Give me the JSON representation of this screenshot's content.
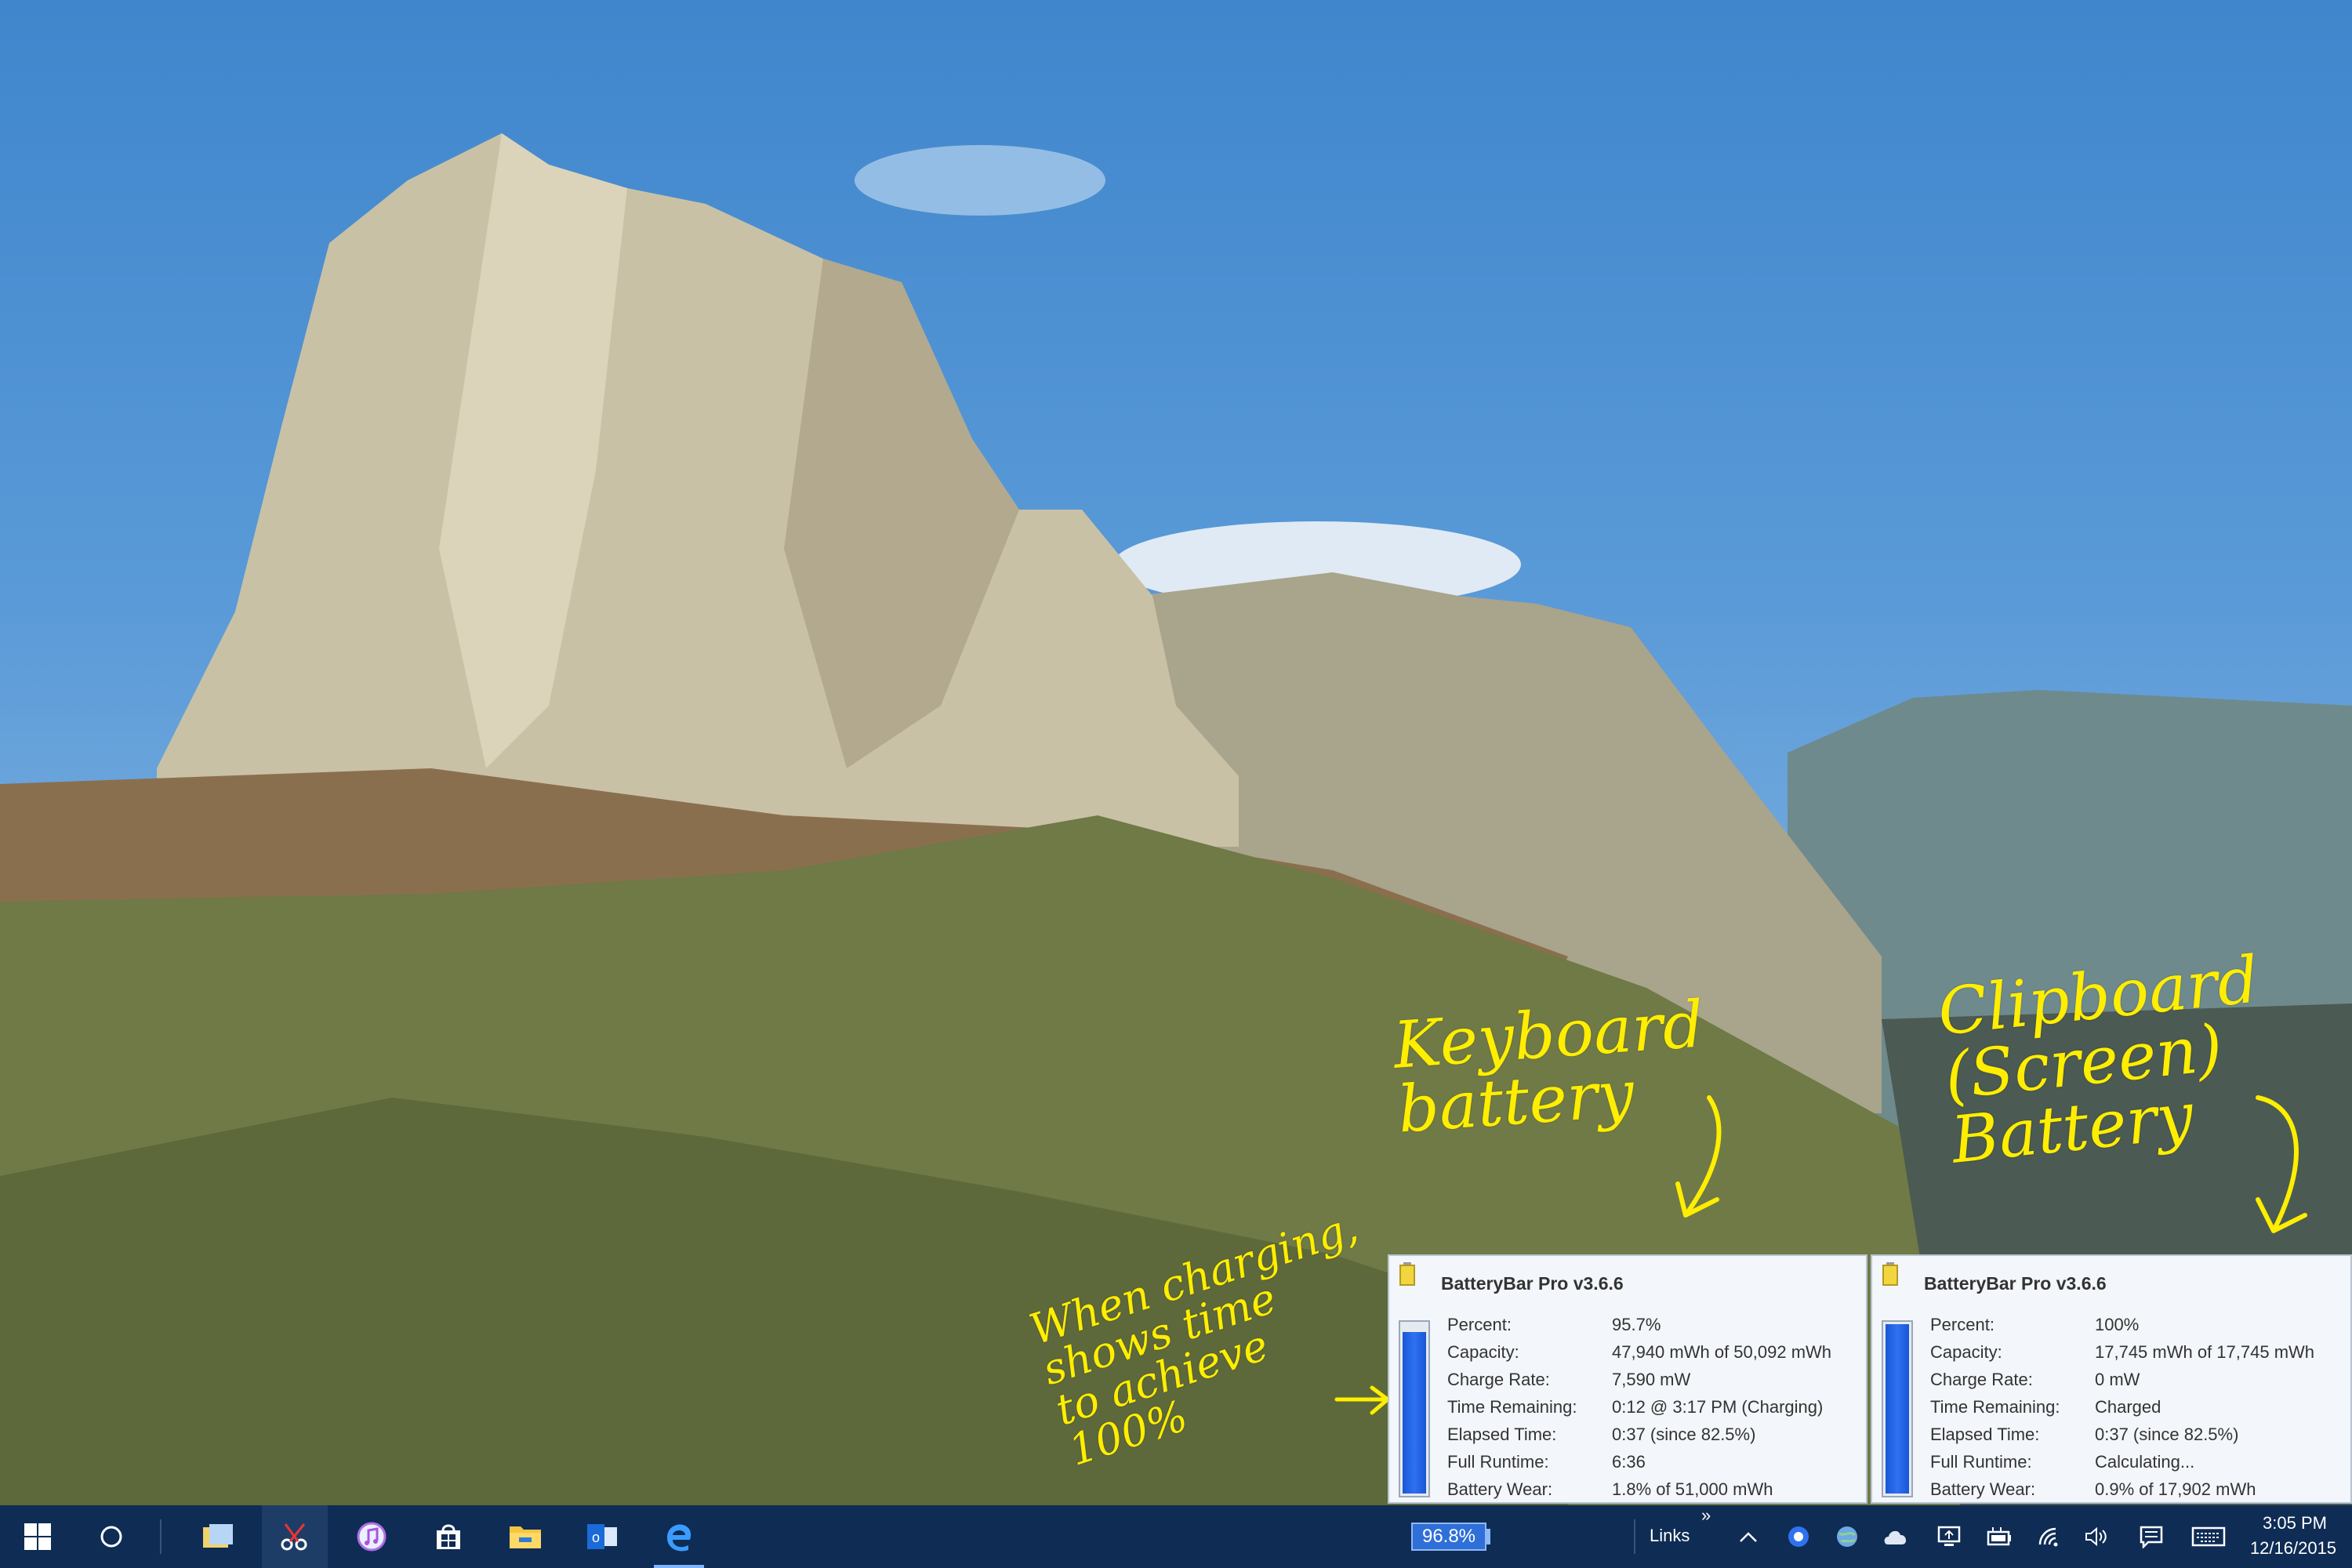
{
  "annotations": {
    "keyboard": "Keyboard\nbattery",
    "clipboard": "Clipboard\n(Screen)\nBattery",
    "charging": "When charging,\nshows time\nto achieve\n100%"
  },
  "popups": [
    {
      "title": "BatteryBar Pro v3.6.6",
      "level": 0.957,
      "rows": [
        {
          "label": "Percent:",
          "value": "95.7%"
        },
        {
          "label": "Capacity:",
          "value": "47,940 mWh of 50,092 mWh"
        },
        {
          "label": "Charge Rate:",
          "value": "7,590 mW"
        },
        {
          "label": "Time Remaining:",
          "value": "0:12 @ 3:17 PM (Charging)"
        },
        {
          "label": "Elapsed Time:",
          "value": "0:37 (since 82.5%)"
        },
        {
          "label": "Full Runtime:",
          "value": "6:36"
        },
        {
          "label": "Battery Wear:",
          "value": "1.8% of 51,000 mWh"
        }
      ]
    },
    {
      "title": "BatteryBar Pro v3.6.6",
      "level": 1.0,
      "rows": [
        {
          "label": "Percent:",
          "value": "100%"
        },
        {
          "label": "Capacity:",
          "value": "17,745 mWh of 17,745 mWh"
        },
        {
          "label": "Charge Rate:",
          "value": "0 mW"
        },
        {
          "label": "Time Remaining:",
          "value": "Charged"
        },
        {
          "label": "Elapsed Time:",
          "value": "0:37 (since 82.5%)"
        },
        {
          "label": "Full Runtime:",
          "value": "Calculating..."
        },
        {
          "label": "Battery Wear:",
          "value": "0.9% of 17,902 mWh"
        }
      ]
    }
  ],
  "taskbar": {
    "battery_percent": "96.8%",
    "links_label": "Links",
    "links_chevron": "»",
    "clock_time": "3:05 PM",
    "clock_date": "12/16/2015",
    "pinned_icons": [
      "windows-start-icon",
      "cortana-icon",
      "file-explorer-notes-icon",
      "snipping-tool-icon",
      "itunes-icon",
      "store-icon",
      "folder-icon",
      "outlook-icon",
      "edge-icon"
    ],
    "tray_icons": [
      "show-hidden-icons-chevron",
      "webcam-icon",
      "globe-icon",
      "cloud-icon",
      "display-icon",
      "battery-power-icon",
      "wifi-icon",
      "volume-icon",
      "action-center-icon",
      "keyboard-icon"
    ]
  },
  "colors": {
    "annotation": "#ffee00",
    "taskbar": "#0e2c54",
    "gauge": "#2f72f0"
  }
}
